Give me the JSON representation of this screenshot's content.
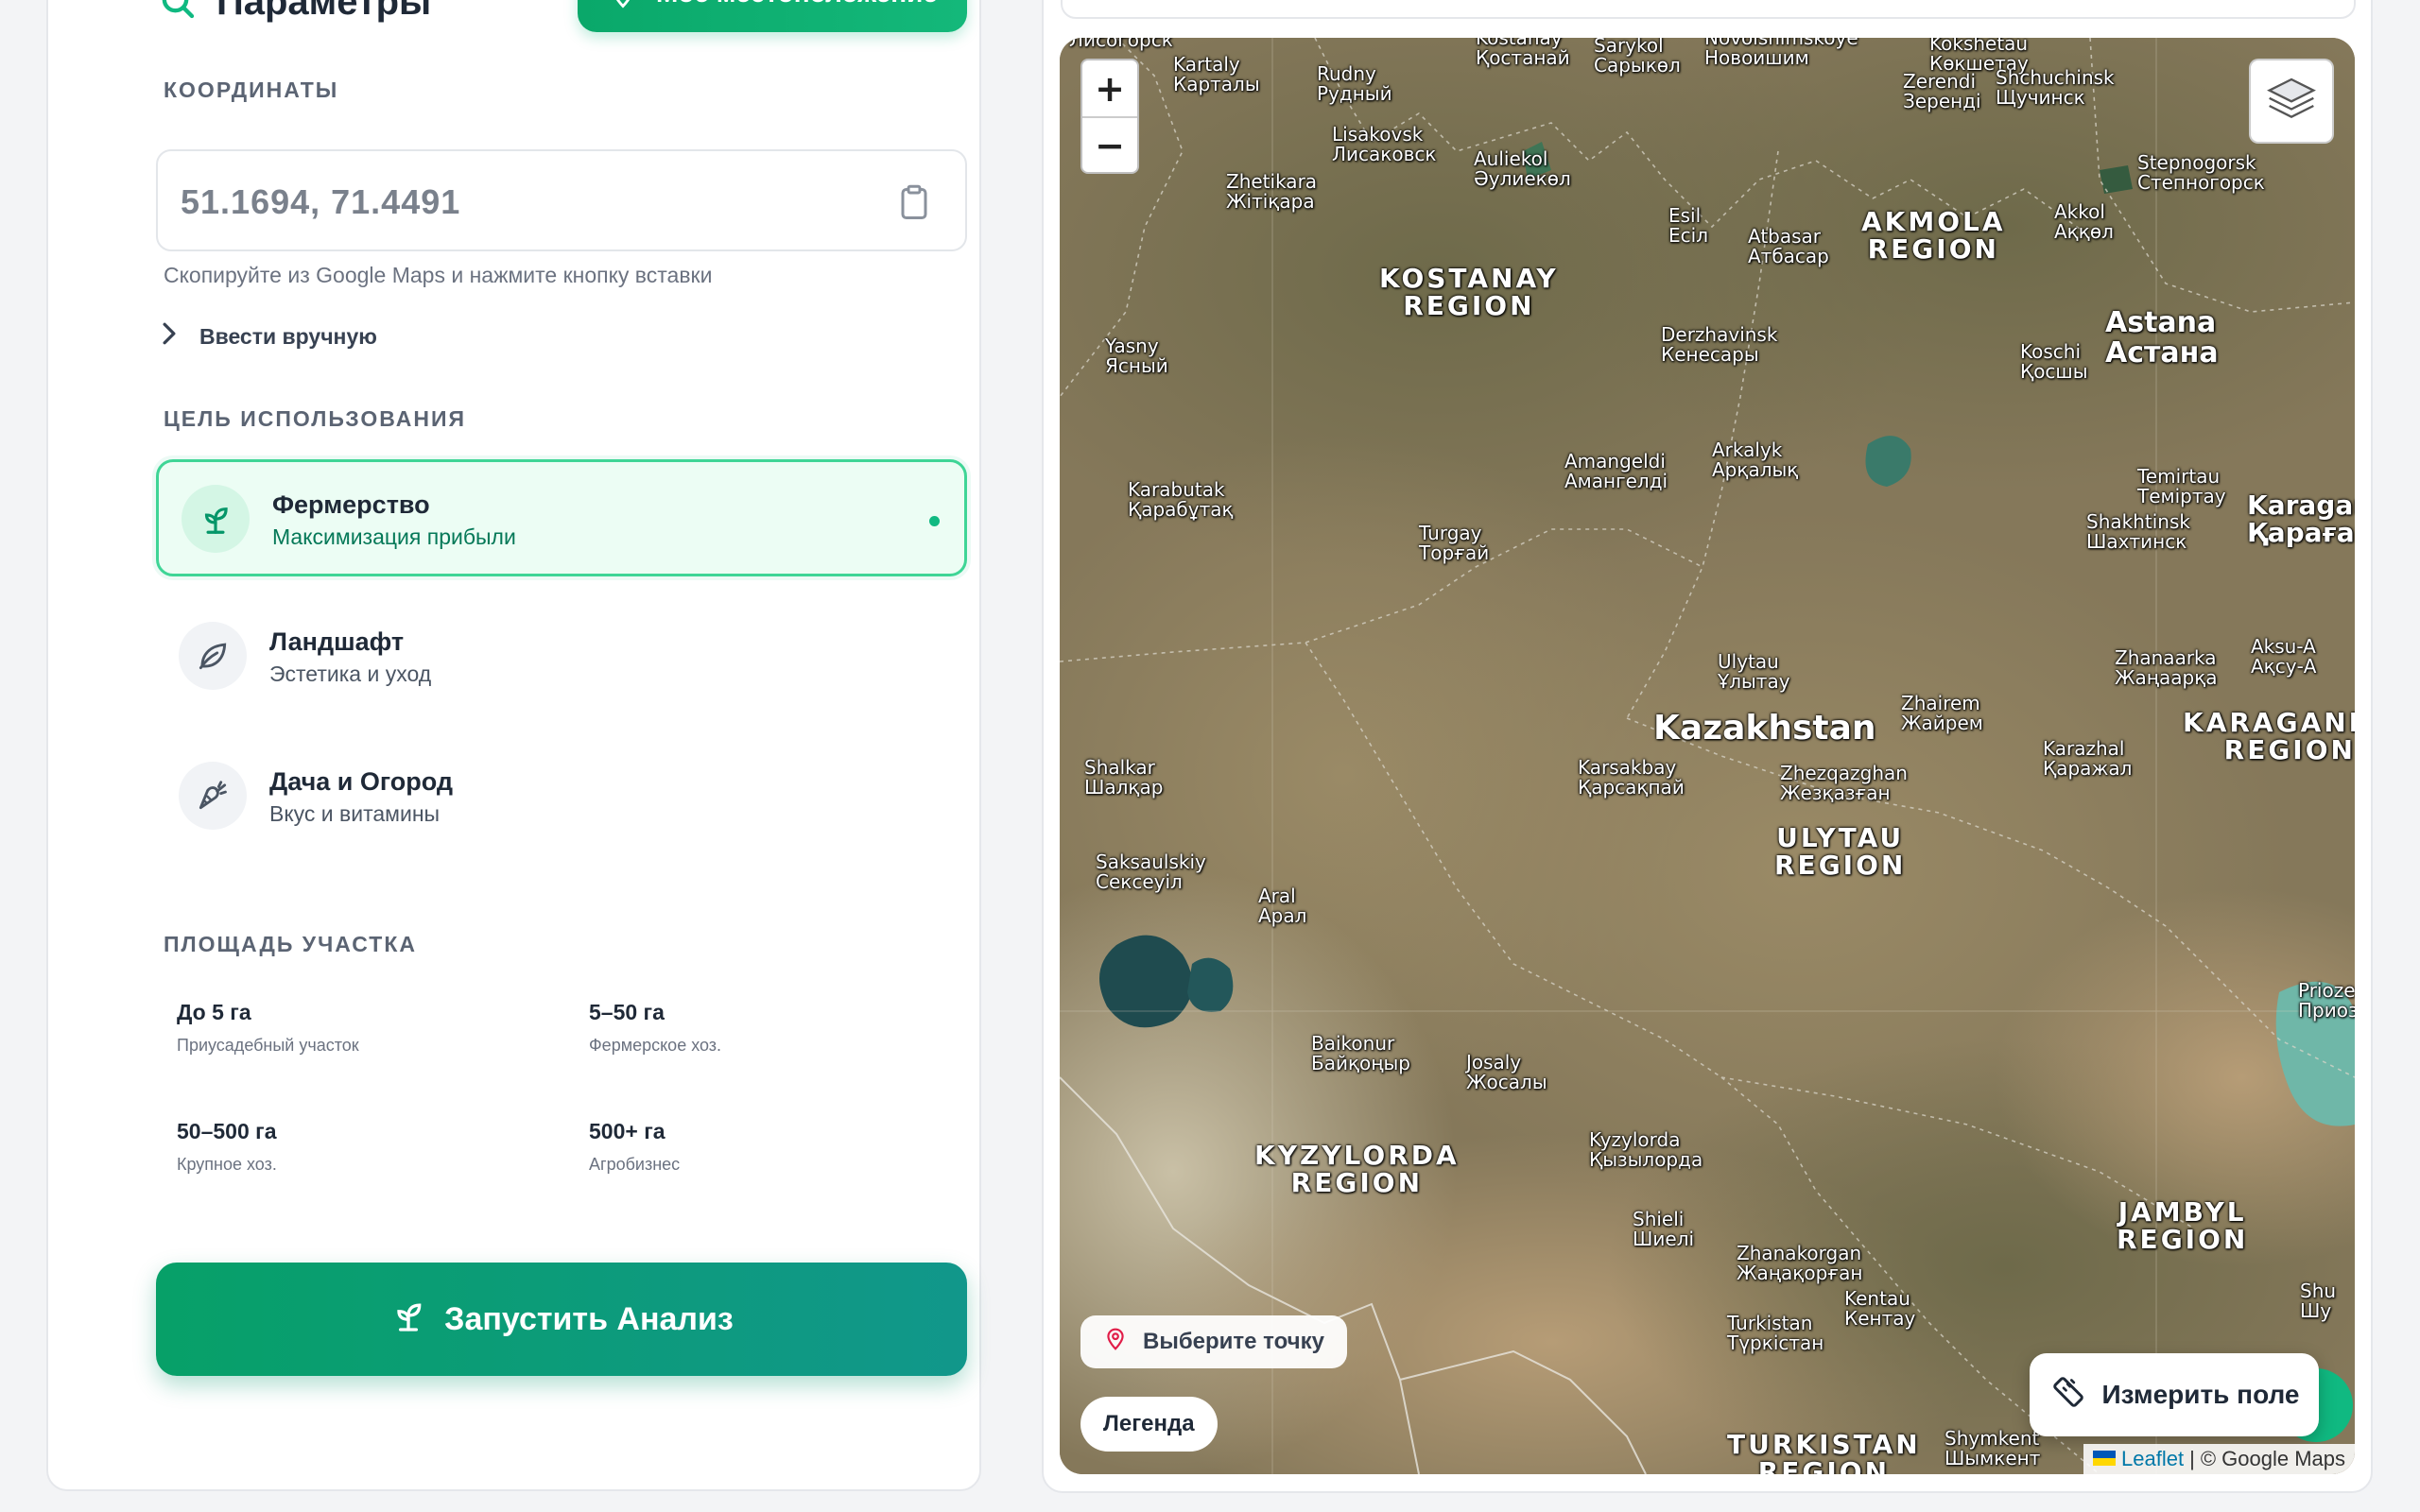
{
  "params": {
    "title": "Параметры",
    "location_button": "Моё местоположение",
    "coordinates_label": "КООРДИНАТЫ",
    "coordinates_placeholder": "51.1694, 71.4491",
    "coordinates_hint": "Скопируйте из Google Maps и нажмите кнопку вставки",
    "manual_entry": "Ввести вручную",
    "purpose_label": "ЦЕЛЬ ИСПОЛЬЗОВАНИЯ",
    "purposes": [
      {
        "title": "Фермерство",
        "subtitle": "Максимизация прибыли",
        "selected": true,
        "icon": "sprout-icon"
      },
      {
        "title": "Ландшафт",
        "subtitle": "Эстетика и уход",
        "selected": false,
        "icon": "leaf-icon"
      },
      {
        "title": "Дача и Огород",
        "subtitle": "Вкус и витамины",
        "selected": false,
        "icon": "carrot-icon"
      }
    ],
    "area_label": "ПЛОЩАДЬ УЧАСТКА",
    "areas": [
      {
        "title": "До 5 га",
        "subtitle": "Приусадебный участок"
      },
      {
        "title": "5–50 га",
        "subtitle": "Фермерское хоз."
      },
      {
        "title": "50–500 га",
        "subtitle": "Крупное хоз."
      },
      {
        "title": "500+ га",
        "subtitle": "Агробизнес"
      }
    ],
    "run_button": "Запустить Анализ"
  },
  "map": {
    "zoom_in": "+",
    "zoom_out": "−",
    "pick_point": "Выберите точку",
    "legend": "Легенда",
    "measure_button": "Измерить поле",
    "attribution_leaflet": "Leaflet",
    "attribution_separator": "|",
    "attribution_source": "© Google Maps",
    "labels": {
      "country": "Kazakhstan",
      "regions": [
        "KOSTANAY\nREGION",
        "AKMOLA\nREGION",
        "ULYTAU\nREGION",
        "KARAGANDA\nREGION",
        "KYZYLORDA\nREGION",
        "JAMBYL\nREGION",
        "TURKISTAN\nREGION"
      ],
      "cities": [
        "Лисогорск",
        "Kostanay\nҚостанай",
        "Sarykol\nСарыкөл",
        "Novoishimskoye\nНовоишим",
        "Kokshetau\nКөкшетау",
        "Kartaly\nКарталы",
        "Rudny\nРудный",
        "Zerendi\nЗеренді",
        "Shchuchinsk\nЩучинск",
        "Lisakovsk\nЛисаковск",
        "Auliekol\nӘулиекөл",
        "Zhetikara\nЖітіқара",
        "Stepnogorsk\nСтепногорск",
        "Esil\nЕсіл",
        "Atbasar\nАтбасар",
        "Akkol\nАққөл",
        "Astana\nАстана",
        "Yasny\nЯсный",
        "Derzhavinsk\nКенесары",
        "Koschi\nҚосшы",
        "Amangeldi\nАмангелді",
        "Arkalyk\nАрқалық",
        "Temirtau\nТеміртау",
        "Karabutak\nҚарабұтақ",
        "Turgay\nТорғай",
        "Shakhtinsk\nШахтинск",
        "Karagan\nҚараған",
        "Ulytau\nҰлытау",
        "Zhanaarka\nЖаңаарқа",
        "Aksu-A\nАқсу-А",
        "Zhairem\nЖайрем",
        "Shalkar\nШалқар",
        "Karsakbay\nҚарсақпай",
        "Zhezqazghan\nЖезқазған",
        "Karazhal\nҚаражал",
        "Saksaulskiy\nСексеуіл",
        "Aral\nАрал",
        "Priozе\nПриоз",
        "Baikonur\nБайқоңыр",
        "Josaly\nЖосалы",
        "Kyzylorda\nҚызылорда",
        "Shieli\nШиелі",
        "Zhanakorgan\nЖаңақорған",
        "Shu\nШу",
        "Kentau\nКентау",
        "Turkistan\nТүркістан",
        "Shymkent\nШымкент"
      ]
    }
  },
  "colors": {
    "accent": "#10b981",
    "accent_dark": "#059669",
    "active_bg": "#ecfdf4",
    "active_border": "#3fd596"
  }
}
